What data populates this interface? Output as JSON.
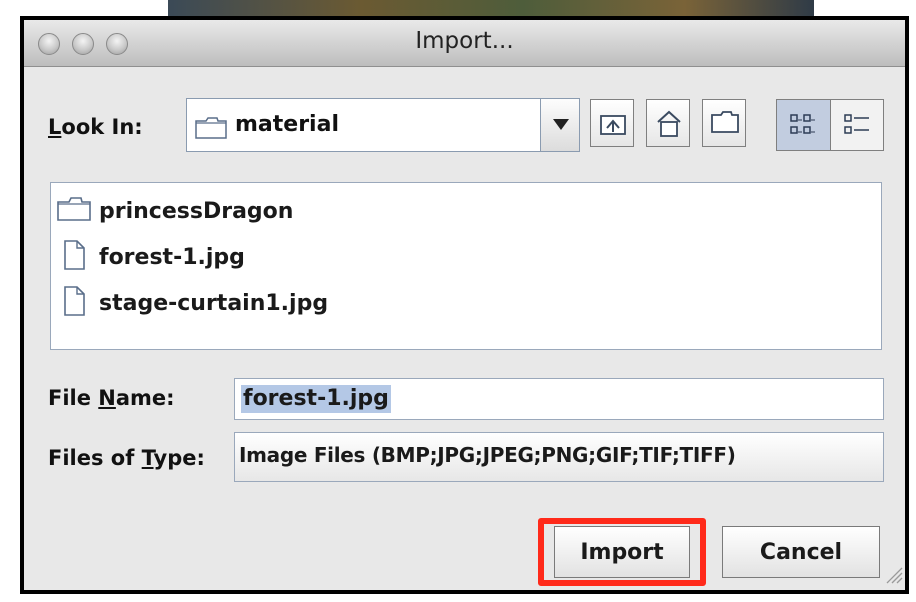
{
  "window": {
    "title": "Import..."
  },
  "look_in": {
    "label": "Look In:",
    "label_mnemonic": "L",
    "label_rest": "ook In:",
    "value": "material"
  },
  "toolbar": {
    "icons": [
      "up-folder-icon",
      "home-icon",
      "new-folder-icon",
      "list-view-icon",
      "details-view-icon"
    ]
  },
  "files": [
    {
      "name": "princessDragon",
      "kind": "folder"
    },
    {
      "name": "forest-1.jpg",
      "kind": "file"
    },
    {
      "name": "stage-curtain1.jpg",
      "kind": "file"
    }
  ],
  "file_name": {
    "label_prefix": "File ",
    "label_mnemonic": "N",
    "label_rest": "ame:",
    "value": "forest-1.jpg"
  },
  "file_type": {
    "label_prefix": "Files of ",
    "label_mnemonic": "T",
    "label_rest": "ype:",
    "value": "Image Files (BMP;JPG;JPEG;PNG;GIF;TIF;TIFF)"
  },
  "buttons": {
    "import": "Import",
    "cancel": "Cancel"
  },
  "colors": {
    "highlight": "#ff2a1a",
    "selection": "#b4c8e6"
  }
}
